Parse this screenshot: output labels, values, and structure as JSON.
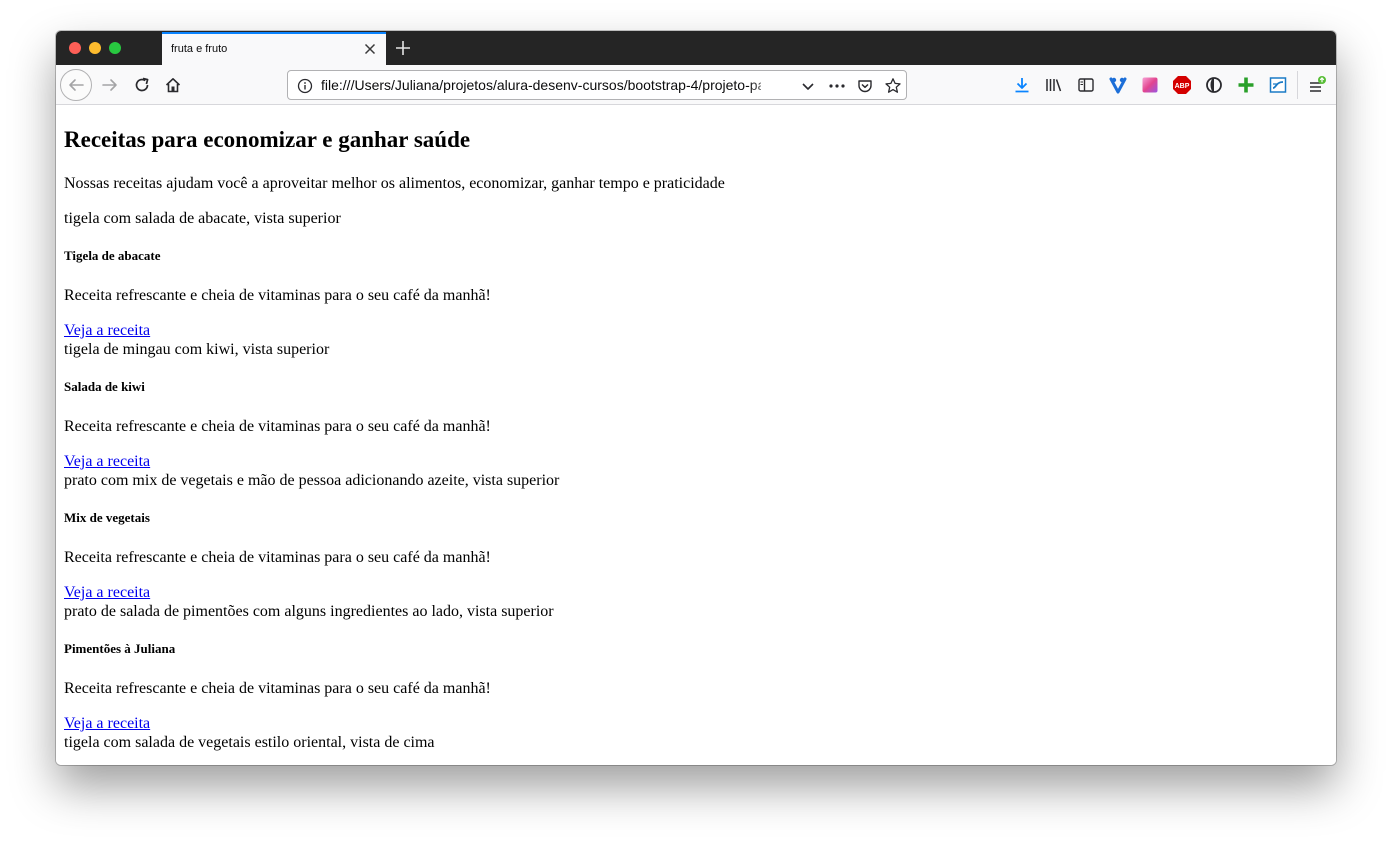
{
  "browser": {
    "tab_title": "fruta e fruto",
    "url": "file:///Users/Juliana/projetos/alura-desenv-cursos/bootstrap-4/projeto-passo-a-passo/index.html",
    "accent_color": "#0a84ff",
    "toolbar_icons": [
      "back-icon",
      "forward-icon",
      "reload-icon",
      "home-icon"
    ],
    "url_icons": [
      "info-icon",
      "dropdown-icon",
      "more-icon",
      "pocket-icon",
      "bookmark-star-icon"
    ],
    "extension_icons": [
      "download-icon",
      "library-icon",
      "sidebar-icon",
      "vivaldi-extension-icon",
      "gradient-extension-icon",
      "adblock-plus-icon",
      "ghostery-icon",
      "green-plus-icon",
      "screenshot-icon",
      "menu-icon"
    ],
    "extensions": {
      "adblock_label": "ABP"
    }
  },
  "page": {
    "title": "Receitas para economizar e ganhar saúde",
    "intro": "Nossas receitas ajudam você a aproveitar melhor os alimentos, economizar, ganhar tempo e praticidade",
    "first_image_alt": "tigela com salada de abacate, vista superior",
    "cards": [
      {
        "title": "Tigela de abacate",
        "text": "Receita refrescante e cheia de vitaminas para o seu café da manhã!",
        "link": "Veja a receita",
        "next_image_alt": "tigela de mingau com kiwi, vista superior"
      },
      {
        "title": "Salada de kiwi",
        "text": "Receita refrescante e cheia de vitaminas para o seu café da manhã!",
        "link": "Veja a receita",
        "next_image_alt": "prato com mix de vegetais e mão de pessoa adicionando azeite, vista superior"
      },
      {
        "title": "Mix de vegetais",
        "text": "Receita refrescante e cheia de vitaminas para o seu café da manhã!",
        "link": "Veja a receita",
        "next_image_alt": "prato de salada de pimentões com alguns ingredientes ao lado, vista superior"
      },
      {
        "title": "Pimentões à Juliana",
        "text": "Receita refrescante e cheia de vitaminas para o seu café da manhã!",
        "link": "Veja a receita",
        "next_image_alt": "tigela com salada de vegetais estilo oriental, vista de cima"
      }
    ],
    "link_color": "#0000ee"
  }
}
